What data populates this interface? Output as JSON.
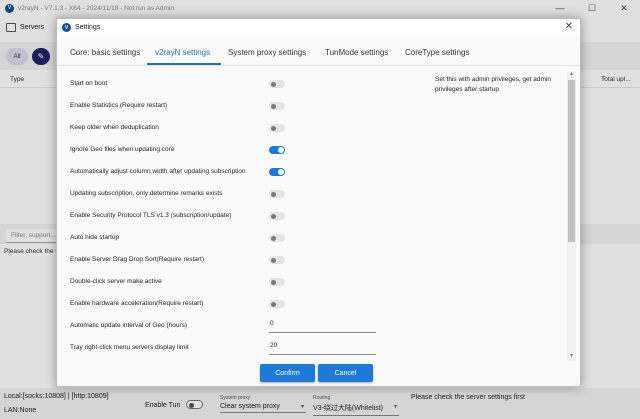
{
  "main_window": {
    "title": "v2rayN - V7.1.3 - X64 - 2024/11/18 - Not run as Admin",
    "controls": {
      "minimize": "—",
      "maximize": "☐",
      "close": "✕"
    },
    "menu": {
      "servers_label": "Servers"
    },
    "filter_all_label": "All",
    "grid": {
      "col_type": "Type",
      "col_total_upload": "Total upl..."
    },
    "filter_placeholder": "Filter, support...",
    "log_text": "Please check the s..."
  },
  "statusbar": {
    "local": "Local:[socks:10808] | [http:10809]",
    "lan": "LAN:None",
    "tun_label": "Enable Tun",
    "tun_on": false,
    "system_proxy_label": "System proxy",
    "system_proxy_value": "Clear system proxy",
    "routing_label": "Routing",
    "routing_value": "V3-绕过大陆(Whitelist)",
    "message": "Please check the server settings first"
  },
  "dialog": {
    "title": "Settings",
    "close": "✕",
    "tabs": [
      {
        "label": "Core: basic settings",
        "active": false
      },
      {
        "label": "v2rayN settings",
        "active": true
      },
      {
        "label": "System proxy settings",
        "active": false
      },
      {
        "label": "TunMode settings",
        "active": false
      },
      {
        "label": "CoreType settings",
        "active": false
      }
    ],
    "toggles": [
      {
        "label": "Start on boot",
        "on": false
      },
      {
        "label": "Enable Statistics (Require restart)",
        "on": false
      },
      {
        "label": "Keep older when deduplication",
        "on": false
      },
      {
        "label": "Ignore Geo files when updating core",
        "on": true
      },
      {
        "label": "Automatically adjust column width after updating subscription",
        "on": true
      },
      {
        "label": "Updating subscription, only determine remarks exists",
        "on": false
      },
      {
        "label": "Enable Security Protocol TLS v1.3 (subscription/update)",
        "on": false
      },
      {
        "label": "Auto hide startup",
        "on": false
      },
      {
        "label": "Enable Server Drag Drop Sort(Require restart)",
        "on": false
      },
      {
        "label": "Double-click server make active",
        "on": false
      },
      {
        "label": "Enable hardware acceleration(Require restart)",
        "on": false
      }
    ],
    "fields": [
      {
        "label": "Automatic update interval of Geo (hours)",
        "value": "0"
      },
      {
        "label": "Tray right-click menu servers display limit",
        "value": "20"
      }
    ],
    "info": "Set this with admin privileges, get admin privileges after startup",
    "confirm_label": "Confirm",
    "cancel_label": "Cancel",
    "scroll": {
      "up": "▲",
      "down": "▼"
    }
  },
  "colors": {
    "accent": "#1e78d7",
    "tab_active": "#2a6fbf",
    "edit_button": "#1f2366"
  }
}
